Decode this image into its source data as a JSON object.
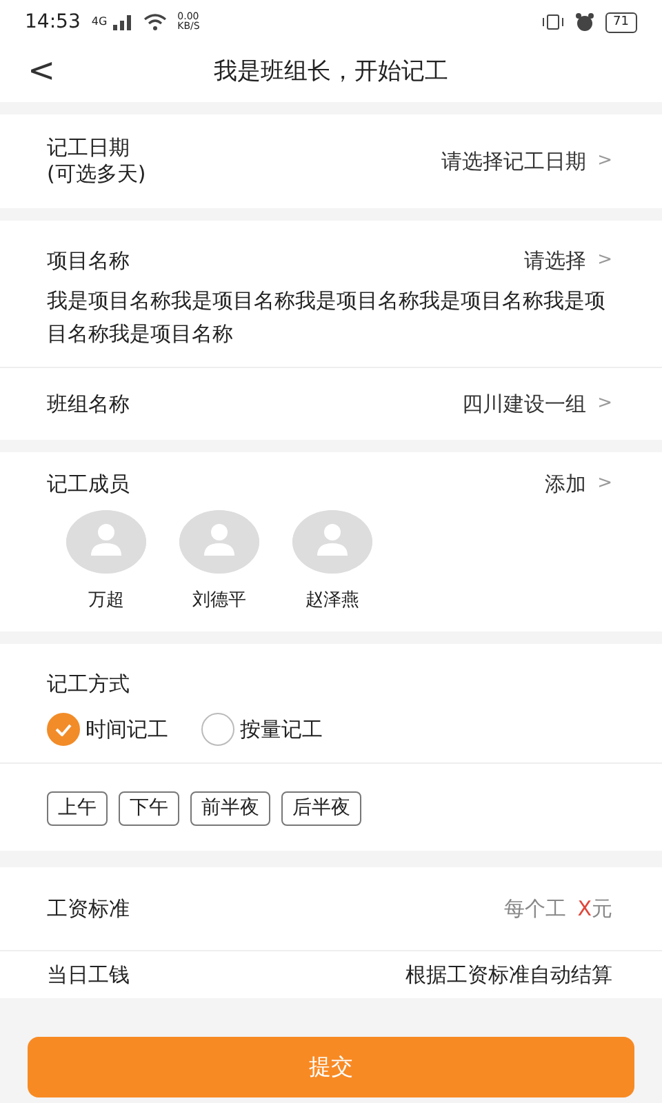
{
  "status_bar": {
    "time": "14:53",
    "network": "4G",
    "speed_value": "0.00",
    "speed_unit": "KB/S",
    "battery": "71"
  },
  "header": {
    "back": "<",
    "title": "我是班组长，开始记工"
  },
  "date_row": {
    "label": "记工日期",
    "sublabel": "(可选多天)",
    "value": "请选择记工日期",
    "chevron": ">"
  },
  "project": {
    "label": "项目名称",
    "value": "请选择",
    "chevron": ">",
    "description": "我是项目名称我是项目名称我是项目名称我是项目名称我是项目名称我是项目名称"
  },
  "team_row": {
    "label": "班组名称",
    "value": "四川建设一组",
    "chevron": ">"
  },
  "members": {
    "label": "记工成员",
    "action": "添加",
    "chevron": ">",
    "people": [
      {
        "name": "万超"
      },
      {
        "name": "刘德平"
      },
      {
        "name": "赵泽燕"
      }
    ]
  },
  "method": {
    "label": "记工方式",
    "options": [
      {
        "label": "时间记工",
        "checked": true
      },
      {
        "label": "按量记工",
        "checked": false
      }
    ]
  },
  "shifts": [
    {
      "label": "上午"
    },
    {
      "label": "下午"
    },
    {
      "label": "前半夜"
    },
    {
      "label": "后半夜"
    }
  ],
  "wage": {
    "label": "工资标准",
    "prefix": "每个工",
    "amount": "X",
    "unit": "元"
  },
  "daily_pay": {
    "label": "当日工钱",
    "value": "根据工资标准自动结算"
  },
  "submit": "提交"
}
